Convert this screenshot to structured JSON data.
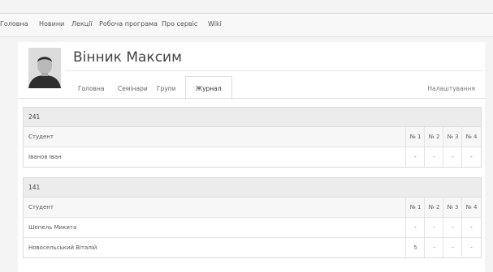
{
  "nav": {
    "items": [
      "Головна",
      "Новини",
      "Лекції",
      "Робоча програма",
      "Про сервіс",
      "Wiki"
    ]
  },
  "profile": {
    "name": "Вінник Максим"
  },
  "tabs": [
    "Головна",
    "Семінари",
    "Групи",
    "Журнал"
  ],
  "active_tab": "Журнал",
  "settings_label": "Налаштування",
  "groups": [
    {
      "title": "241",
      "student_header": "Студент",
      "columns": [
        "№ 1",
        "№ 2",
        "№ 3",
        "№ 4"
      ],
      "rows": [
        {
          "name": "Іванов Іван",
          "marks": [
            "-",
            "-",
            "-",
            "-"
          ]
        }
      ]
    },
    {
      "title": "141",
      "student_header": "Студент",
      "columns": [
        "№ 1",
        "№ 2",
        "№ 3",
        "№ 4"
      ],
      "rows": [
        {
          "name": "Шепель Микита",
          "marks": [
            "-",
            "-",
            "-",
            "-"
          ]
        },
        {
          "name": "Новосельський Віталій",
          "marks": [
            "5",
            "-",
            "-",
            "-"
          ]
        }
      ]
    }
  ]
}
